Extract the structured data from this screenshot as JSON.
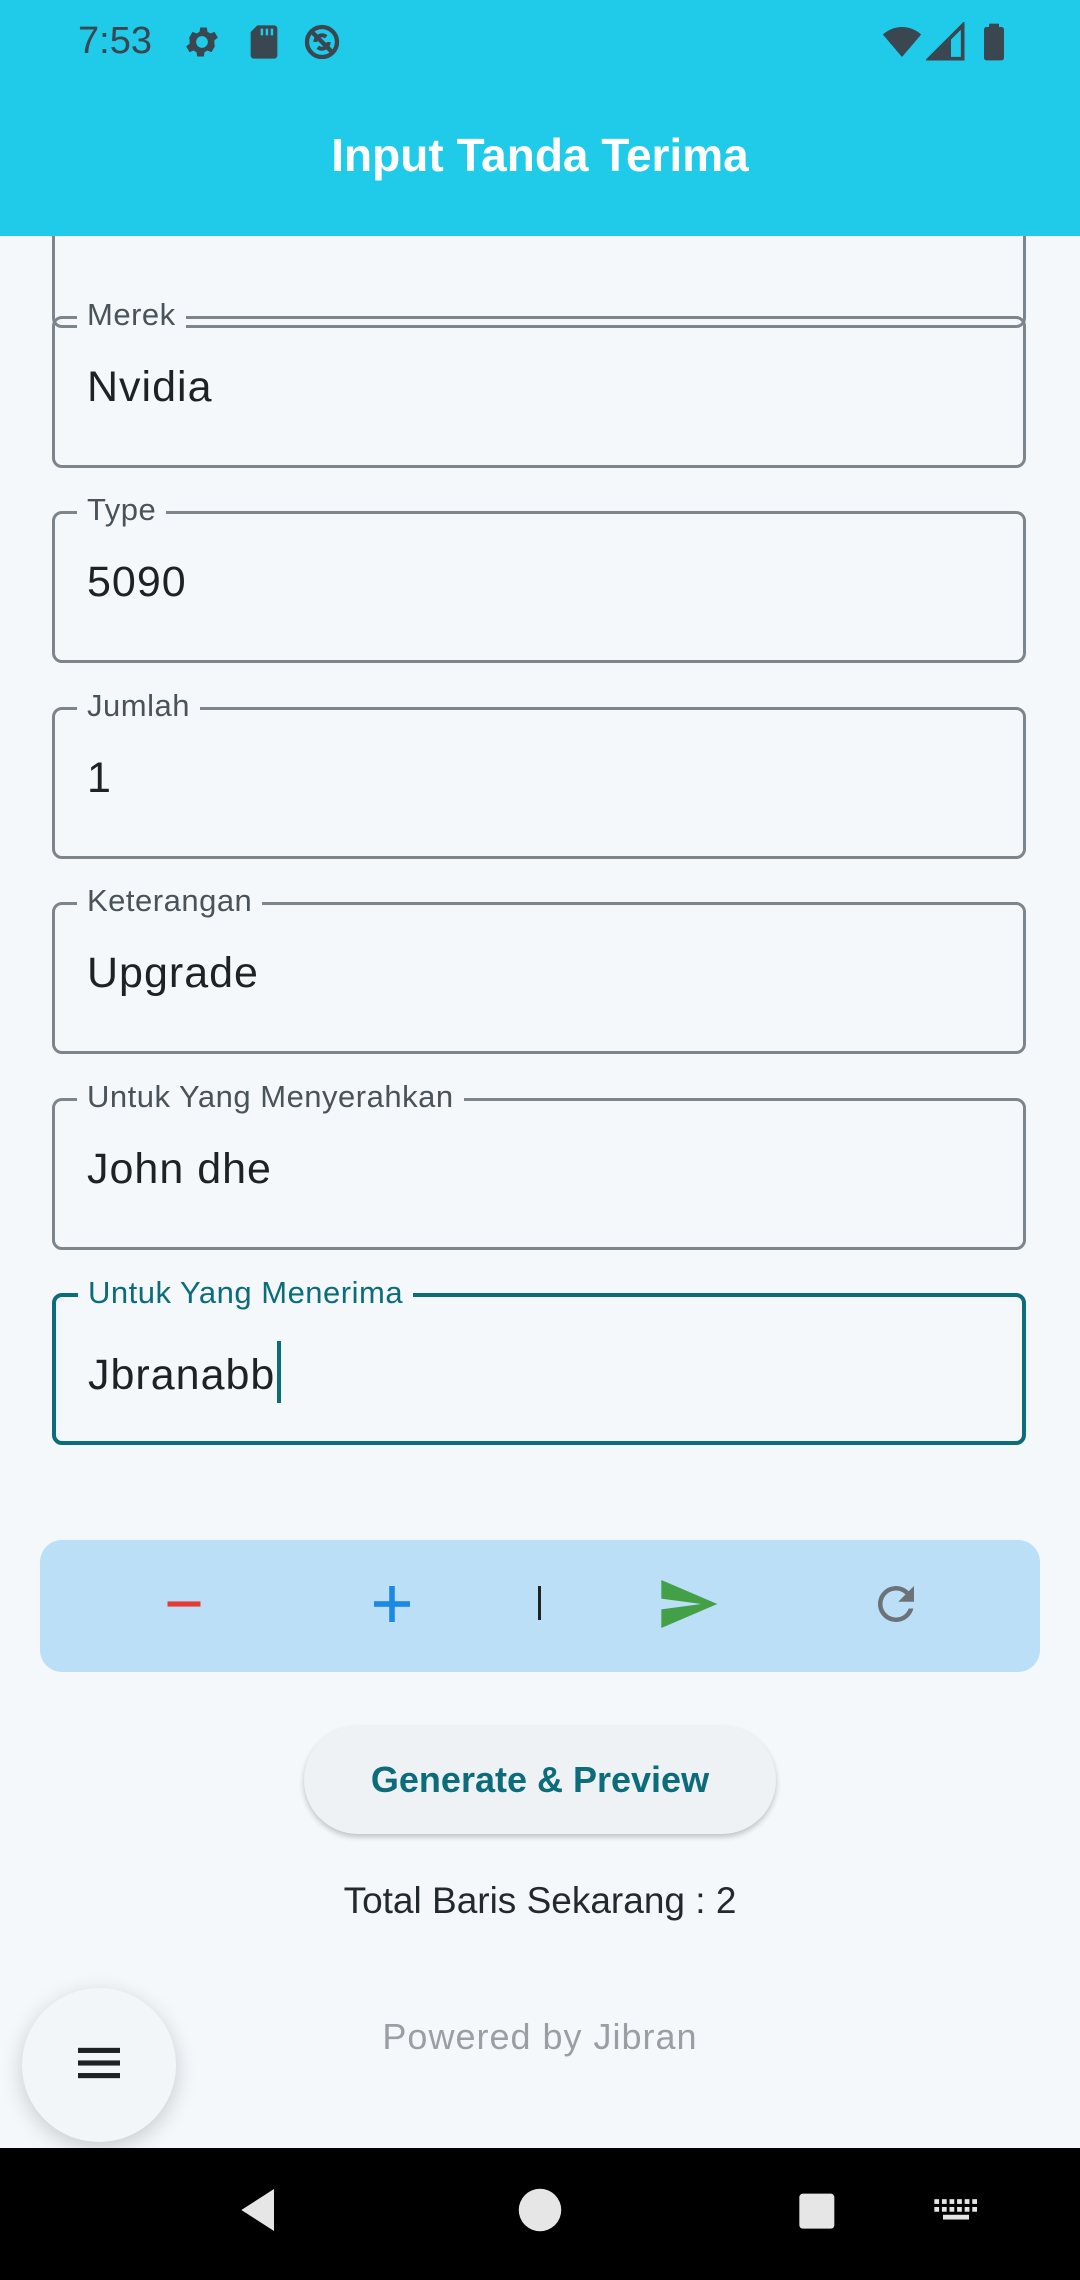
{
  "status_bar": {
    "time": "7:53",
    "left_icons": [
      "settings-icon",
      "sd-card-icon",
      "sync-disabled-icon"
    ],
    "right_icons": [
      "wifi-icon",
      "signal-icon",
      "battery-icon"
    ]
  },
  "app_bar": {
    "title": "Input Tanda Terima"
  },
  "form": {
    "fields": [
      {
        "label": "Merek",
        "value": "Nvidia"
      },
      {
        "label": "Type",
        "value": "5090"
      },
      {
        "label": "Jumlah",
        "value": "1"
      },
      {
        "label": "Keterangan",
        "value": "Upgrade"
      },
      {
        "label": "Untuk Yang Menyerahkan",
        "value": "John dhe"
      },
      {
        "label": "Untuk Yang Menerima",
        "value": "Jbranabb"
      }
    ]
  },
  "toolbar": {
    "separator": "|",
    "icons": [
      "minus-icon",
      "plus-icon",
      "send-icon",
      "refresh-icon"
    ],
    "colors": {
      "minus": "#e53935",
      "plus": "#1e88e5",
      "send": "#43a047",
      "refresh": "#6b7378",
      "background": "#bbdff7"
    }
  },
  "actions": {
    "generate_label": "Generate & Preview"
  },
  "summary": {
    "total_rows_text": "Total Baris Sekarang : 2"
  },
  "footer": {
    "powered_by": "Powered by Jibran"
  },
  "fab": {
    "icon": "menu-icon"
  },
  "nav_bar": {
    "icons": [
      "back-icon",
      "home-icon",
      "recents-icon",
      "keyboard-icon"
    ]
  },
  "colors": {
    "accent": "#1fcbe9",
    "focus": "#0c6c7a"
  }
}
